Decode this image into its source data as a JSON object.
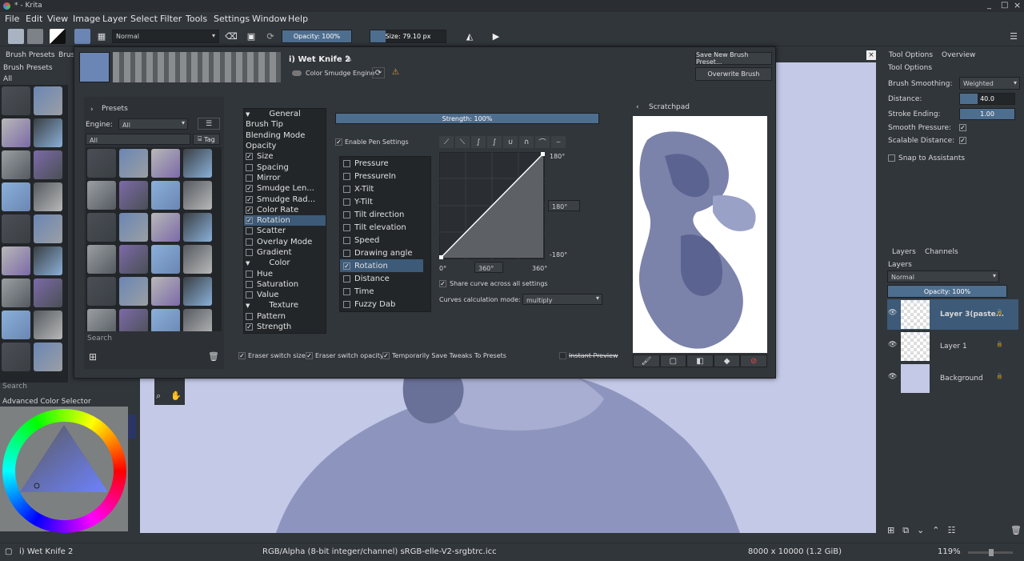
{
  "window": {
    "title": "* - Krita"
  },
  "menu": [
    "File",
    "Edit",
    "View",
    "Image",
    "Layer",
    "Select",
    "Filter",
    "Tools",
    "Settings",
    "Window",
    "Help"
  ],
  "toolbar": {
    "blend_mode": "Normal",
    "opacity": "Opacity: 100%",
    "size": "Size: 79.10 px"
  },
  "left": {
    "tabs": [
      "Brush Presets",
      "Brush"
    ],
    "panel_title": "Brush Presets",
    "filter": "All",
    "search_placeholder": "Search",
    "color_selector_title": "Advanced Color Selector"
  },
  "dialog": {
    "preset_name": "i) Wet Knife 2",
    "engine_label": "Color Smudge Engine",
    "save_new": "Save New Brush Preset...",
    "overwrite": "Overwrite Brush",
    "presets_title": "Presets",
    "engine_text": "Engine:",
    "engine_value": "All",
    "tag_filter": "All",
    "tag_button": "Tag",
    "search_placeholder": "Search",
    "categories": [
      {
        "label": "General",
        "type": "header"
      },
      {
        "label": "Brush Tip",
        "type": "item"
      },
      {
        "label": "Blending Mode",
        "type": "item"
      },
      {
        "label": "Opacity",
        "type": "item"
      },
      {
        "label": "Size",
        "type": "check",
        "checked": true
      },
      {
        "label": "Spacing",
        "type": "check",
        "checked": false
      },
      {
        "label": "Mirror",
        "type": "check",
        "checked": false
      },
      {
        "label": "Smudge Len...",
        "type": "check",
        "checked": true
      },
      {
        "label": "Smudge Rad...",
        "type": "check",
        "checked": true
      },
      {
        "label": "Color Rate",
        "type": "check",
        "checked": true
      },
      {
        "label": "Rotation",
        "type": "check",
        "checked": true,
        "selected": true
      },
      {
        "label": "Scatter",
        "type": "check",
        "checked": false
      },
      {
        "label": "Overlay Mode",
        "type": "check",
        "checked": false
      },
      {
        "label": "Gradient",
        "type": "check",
        "checked": false
      },
      {
        "label": "Color",
        "type": "header"
      },
      {
        "label": "Hue",
        "type": "check",
        "checked": false
      },
      {
        "label": "Saturation",
        "type": "check",
        "checked": false
      },
      {
        "label": "Value",
        "type": "check",
        "checked": false
      },
      {
        "label": "Texture",
        "type": "header"
      },
      {
        "label": "Pattern",
        "type": "check",
        "checked": false
      },
      {
        "label": "Strength",
        "type": "check",
        "checked": true
      }
    ],
    "strength": "Strength: 100%",
    "enable_pen": "Enable Pen Settings",
    "sensors": [
      {
        "label": "Pressure",
        "checked": false
      },
      {
        "label": "PressureIn",
        "checked": false
      },
      {
        "label": "X-Tilt",
        "checked": false
      },
      {
        "label": "Y-Tilt",
        "checked": false
      },
      {
        "label": "Tilt direction",
        "checked": false
      },
      {
        "label": "Tilt elevation",
        "checked": false
      },
      {
        "label": "Speed",
        "checked": false
      },
      {
        "label": "Drawing angle",
        "checked": false
      },
      {
        "label": "Rotation",
        "checked": true,
        "selected": true
      },
      {
        "label": "Distance",
        "checked": false
      },
      {
        "label": "Time",
        "checked": false
      },
      {
        "label": "Fuzzy Dab",
        "checked": false
      }
    ],
    "curve_top": "180°",
    "curve_mid": "180°",
    "curve_bottom": "-180°",
    "curve_x0": "0°",
    "curve_xmid": "360°",
    "curve_xmax": "360°",
    "share_curve": "Share curve across all settings",
    "calc_mode_label": "Curves calculation mode:",
    "calc_mode_value": "multiply",
    "scratchpad_title": "Scratchpad",
    "eraser_size": "Eraser switch size",
    "eraser_opacity": "Eraser switch opacity",
    "temp_save": "Temporarily Save Tweaks To Presets",
    "instant_preview": "Instant Preview"
  },
  "right": {
    "tabs": [
      "Tool Options",
      "Overview"
    ],
    "title": "Tool Options",
    "brush_smoothing_label": "Brush Smoothing:",
    "brush_smoothing_value": "Weighted",
    "distance_label": "Distance:",
    "distance_value": "40.0",
    "stroke_ending_label": "Stroke Ending:",
    "stroke_ending_value": "1.00",
    "smooth_pressure": "Smooth Pressure:",
    "scalable_distance": "Scalable Distance:",
    "snap_assistants": "Snap to Assistants",
    "layers_tabs": [
      "Layers",
      "Channels"
    ],
    "layers_title": "Layers",
    "layer_blend": "Normal",
    "layer_opacity": "Opacity: 100%",
    "layers": [
      {
        "name": "Layer 3(paste...",
        "selected": true
      },
      {
        "name": "Layer 1",
        "selected": false
      },
      {
        "name": "Background",
        "selected": false
      }
    ]
  },
  "status": {
    "brush": "i) Wet Knife 2",
    "color_space": "RGB/Alpha (8-bit integer/channel)  sRGB-elle-V2-srgbtrc.icc",
    "dims": "8000 x 10000 (1.2 GiB)",
    "zoom": "119%"
  },
  "colors": {
    "accent": "#3d5a78",
    "canvas": "#c3c9e6",
    "paint": "#5a6390"
  }
}
